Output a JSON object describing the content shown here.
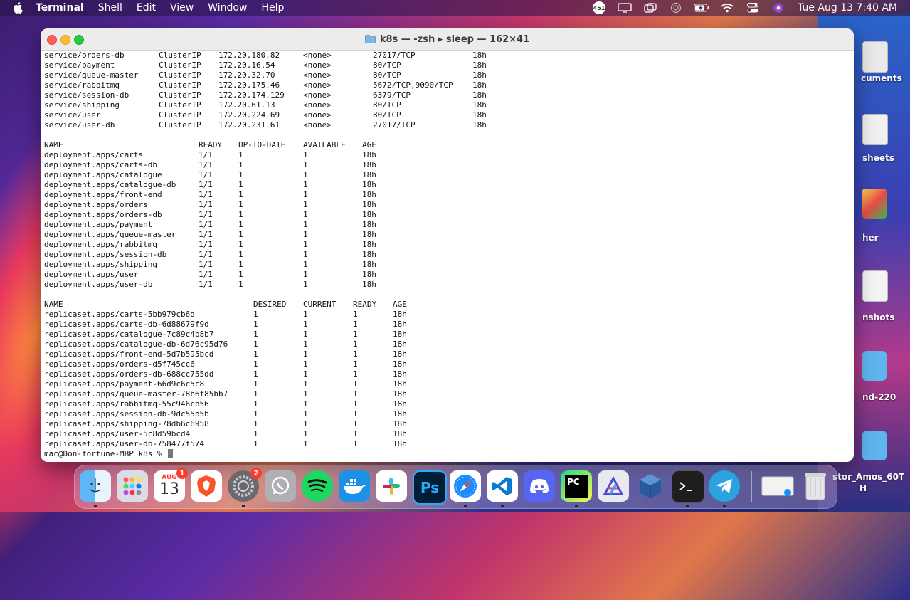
{
  "menubar": {
    "app_name": "Terminal",
    "items": [
      "Shell",
      "Edit",
      "View",
      "Window",
      "Help"
    ],
    "notification_count": "451",
    "clock": "Tue Aug 13  7:40 AM"
  },
  "desktop_labels": [
    "cuments",
    "sheets",
    "her",
    "nshots",
    "nd-220",
    "stor_Amos_60T",
    "H"
  ],
  "window": {
    "title": "k8s — -zsh ▸ sleep — 162×41"
  },
  "terminal": {
    "services": [
      {
        "name": "service/orders-db",
        "type": "ClusterIP",
        "cluster_ip": "172.20.180.82",
        "external_ip": "<none>",
        "ports": "27017/TCP",
        "age": "18h"
      },
      {
        "name": "service/payment",
        "type": "ClusterIP",
        "cluster_ip": "172.20.16.54",
        "external_ip": "<none>",
        "ports": "80/TCP",
        "age": "18h"
      },
      {
        "name": "service/queue-master",
        "type": "ClusterIP",
        "cluster_ip": "172.20.32.70",
        "external_ip": "<none>",
        "ports": "80/TCP",
        "age": "18h"
      },
      {
        "name": "service/rabbitmq",
        "type": "ClusterIP",
        "cluster_ip": "172.20.175.46",
        "external_ip": "<none>",
        "ports": "5672/TCP,9090/TCP",
        "age": "18h"
      },
      {
        "name": "service/session-db",
        "type": "ClusterIP",
        "cluster_ip": "172.20.174.129",
        "external_ip": "<none>",
        "ports": "6379/TCP",
        "age": "18h"
      },
      {
        "name": "service/shipping",
        "type": "ClusterIP",
        "cluster_ip": "172.20.61.13",
        "external_ip": "<none>",
        "ports": "80/TCP",
        "age": "18h"
      },
      {
        "name": "service/user",
        "type": "ClusterIP",
        "cluster_ip": "172.20.224.69",
        "external_ip": "<none>",
        "ports": "80/TCP",
        "age": "18h"
      },
      {
        "name": "service/user-db",
        "type": "ClusterIP",
        "cluster_ip": "172.20.231.61",
        "external_ip": "<none>",
        "ports": "27017/TCP",
        "age": "18h"
      }
    ],
    "deployment_headers": [
      "NAME",
      "READY",
      "UP-TO-DATE",
      "AVAILABLE",
      "AGE"
    ],
    "deployments": [
      [
        "deployment.apps/carts",
        "1/1",
        "1",
        "1",
        "18h"
      ],
      [
        "deployment.apps/carts-db",
        "1/1",
        "1",
        "1",
        "18h"
      ],
      [
        "deployment.apps/catalogue",
        "1/1",
        "1",
        "1",
        "18h"
      ],
      [
        "deployment.apps/catalogue-db",
        "1/1",
        "1",
        "1",
        "18h"
      ],
      [
        "deployment.apps/front-end",
        "1/1",
        "1",
        "1",
        "18h"
      ],
      [
        "deployment.apps/orders",
        "1/1",
        "1",
        "1",
        "18h"
      ],
      [
        "deployment.apps/orders-db",
        "1/1",
        "1",
        "1",
        "18h"
      ],
      [
        "deployment.apps/payment",
        "1/1",
        "1",
        "1",
        "18h"
      ],
      [
        "deployment.apps/queue-master",
        "1/1",
        "1",
        "1",
        "18h"
      ],
      [
        "deployment.apps/rabbitmq",
        "1/1",
        "1",
        "1",
        "18h"
      ],
      [
        "deployment.apps/session-db",
        "1/1",
        "1",
        "1",
        "18h"
      ],
      [
        "deployment.apps/shipping",
        "1/1",
        "1",
        "1",
        "18h"
      ],
      [
        "deployment.apps/user",
        "1/1",
        "1",
        "1",
        "18h"
      ],
      [
        "deployment.apps/user-db",
        "1/1",
        "1",
        "1",
        "18h"
      ]
    ],
    "replicaset_headers": [
      "NAME",
      "DESIRED",
      "CURRENT",
      "READY",
      "AGE"
    ],
    "replicasets": [
      [
        "replicaset.apps/carts-5bb979cb6d",
        "1",
        "1",
        "1",
        "18h"
      ],
      [
        "replicaset.apps/carts-db-6d88679f9d",
        "1",
        "1",
        "1",
        "18h"
      ],
      [
        "replicaset.apps/catalogue-7c89c4b8b7",
        "1",
        "1",
        "1",
        "18h"
      ],
      [
        "replicaset.apps/catalogue-db-6d76c95d76",
        "1",
        "1",
        "1",
        "18h"
      ],
      [
        "replicaset.apps/front-end-5d7b595bcd",
        "1",
        "1",
        "1",
        "18h"
      ],
      [
        "replicaset.apps/orders-d5f745cc6",
        "1",
        "1",
        "1",
        "18h"
      ],
      [
        "replicaset.apps/orders-db-688cc755dd",
        "1",
        "1",
        "1",
        "18h"
      ],
      [
        "replicaset.apps/payment-66d9c6c5c8",
        "1",
        "1",
        "1",
        "18h"
      ],
      [
        "replicaset.apps/queue-master-78b6f85bb7",
        "1",
        "1",
        "1",
        "18h"
      ],
      [
        "replicaset.apps/rabbitmq-55c946cb56",
        "1",
        "1",
        "1",
        "18h"
      ],
      [
        "replicaset.apps/session-db-9dc55b5b",
        "1",
        "1",
        "1",
        "18h"
      ],
      [
        "replicaset.apps/shipping-78db6c6958",
        "1",
        "1",
        "1",
        "18h"
      ],
      [
        "replicaset.apps/user-5c8d59bcd4",
        "1",
        "1",
        "1",
        "18h"
      ],
      [
        "replicaset.apps/user-db-758477f574",
        "1",
        "1",
        "1",
        "18h"
      ]
    ],
    "prompt": "mac@Don-fortune-MBP k8s % "
  },
  "dock": {
    "calendar_month": "AUG",
    "calendar_day": "13",
    "calendar_badge": "1",
    "settings_badge": "2",
    "photoshop_label": "Ps",
    "pycharm_label": "PC"
  }
}
